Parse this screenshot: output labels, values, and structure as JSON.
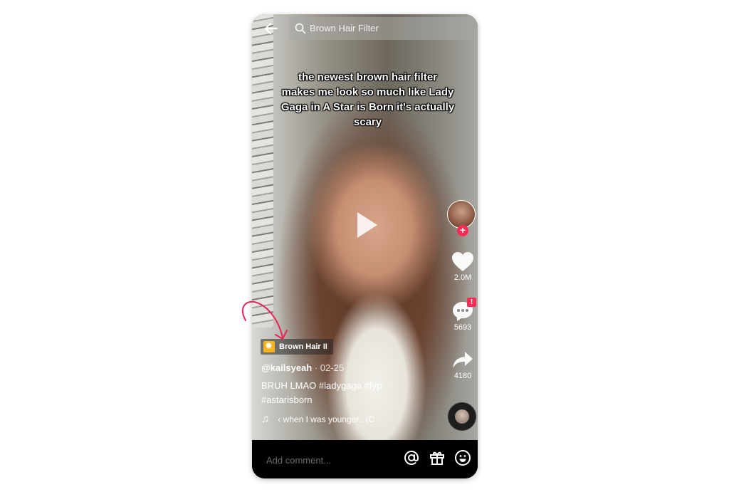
{
  "header": {
    "back_icon": "arrow-left-icon",
    "search_icon": "search-icon",
    "search_query": "Brown Hair Filter"
  },
  "video": {
    "caption": "the newest brown hair filter makes me look so much like Lady Gaga in A Star is Born it's actually scary",
    "play_icon": "play-icon"
  },
  "actions": {
    "likes": "2.0M",
    "comments": "5693",
    "shares": "4180",
    "follow_symbol": "+",
    "gift_badge_symbol": "!"
  },
  "effect": {
    "label": "Brown Hair II"
  },
  "post": {
    "username": "@kailsyeah",
    "separator": " · ",
    "date": "02-25",
    "description": "BRUH LMAO #ladygaga #fyp #astarisborn",
    "music_icon": "♫",
    "music_title": "‹ when I was younger.. (C"
  },
  "bottom": {
    "comment_placeholder": "Add comment...",
    "icons": [
      "at-icon",
      "gift-icon",
      "emoji-icon"
    ]
  },
  "colors": {
    "accent": "#fe2c55",
    "effect_badge": "#f5b51b",
    "annotation": "#e8245a"
  }
}
